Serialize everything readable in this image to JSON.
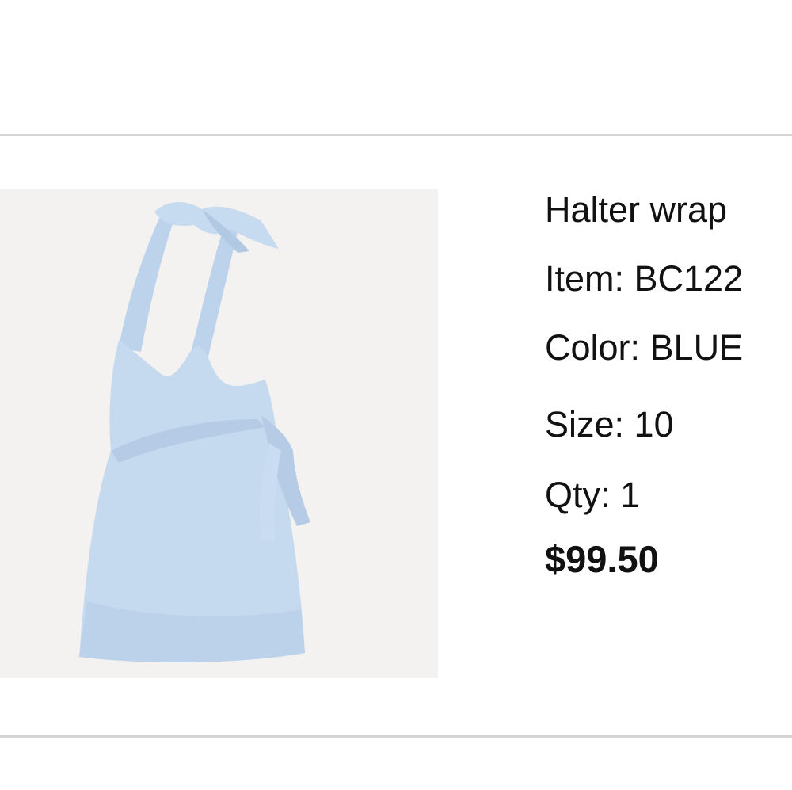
{
  "product": {
    "name": "Halter wrap",
    "item": "Item: BC122",
    "color": "Color: BLUE",
    "size": "Size: 10",
    "qty": "Qty: 1",
    "price": "$99.50",
    "image_alt": "Light blue halter wrap swim top"
  },
  "colors": {
    "divider": "#d4d4d4",
    "image_background": "#f3f2f1",
    "garment": "#c5d9ef",
    "text": "#111111"
  }
}
